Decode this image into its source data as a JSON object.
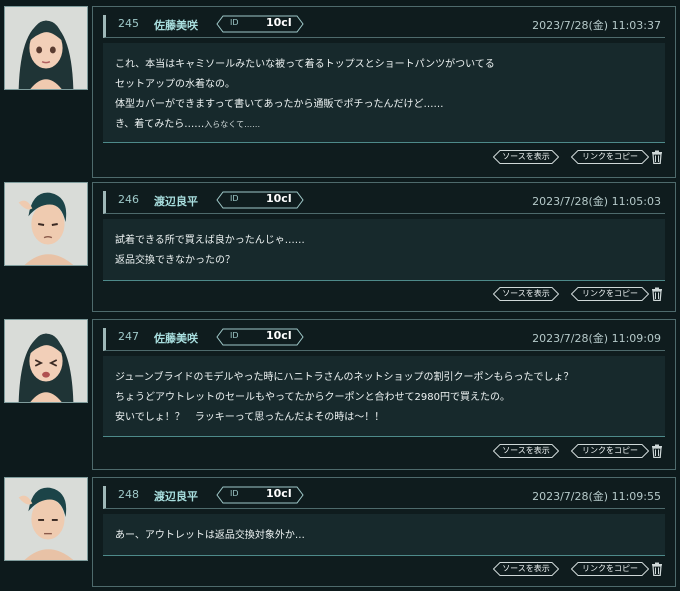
{
  "actions": {
    "source_label": "ソースを表示",
    "copy_label": "リンクをコピー"
  },
  "posts": [
    {
      "number": "245",
      "user": "佐藤美咲",
      "id_label": "ID",
      "id_value": "10cl",
      "timestamp": "2023/7/28(金) 11:03:37",
      "lines": [
        "これ、本当はキャミソールみたいな被って着るトップスとショートパンツがついてる",
        "セットアップの水着なの。",
        "体型カバーができますって書いてあったから通販でポチったんだけど……",
        "き、着てみたら……"
      ],
      "small_suffix": "入らなくて……"
    },
    {
      "number": "246",
      "user": "渡辺良平",
      "id_label": "ID",
      "id_value": "10cl",
      "timestamp": "2023/7/28(金) 11:05:03",
      "lines": [
        "試着できる所で買えば良かったんじゃ……",
        "返品交換できなかったの？"
      ]
    },
    {
      "number": "247",
      "user": "佐藤美咲",
      "id_label": "ID",
      "id_value": "10cl",
      "timestamp": "2023/7/28(金) 11:09:09",
      "lines": [
        "ジューンブライドのモデルやった時にハニトラさんのネットショップの割引クーポンもらったでしょ？",
        "ちょうどアウトレットのセールもやってたからクーポンと合わせて2980円で買えたの。",
        "安いでしょ！？　ラッキーって思ったんだよその時は〜！！"
      ]
    },
    {
      "number": "248",
      "user": "渡辺良平",
      "id_label": "ID",
      "id_value": "10cl",
      "timestamp": "2023/7/28(金) 11:09:55",
      "lines": [
        "あー、アウトレットは返品交換対象外か…"
      ]
    }
  ]
}
